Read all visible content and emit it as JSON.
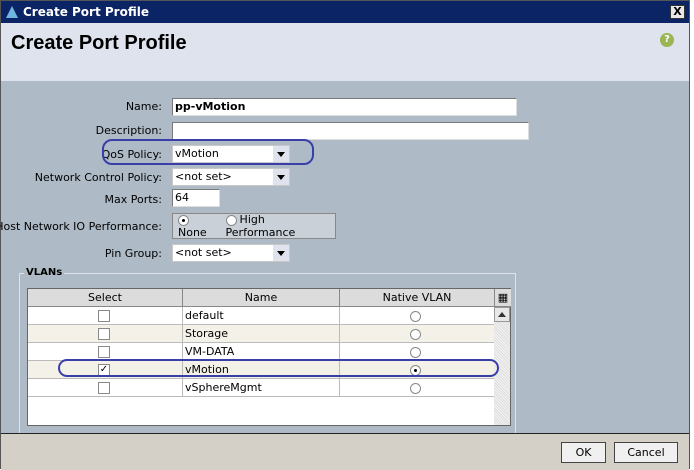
{
  "window": {
    "title": "Create Port Profile",
    "close": "X"
  },
  "header": {
    "title": "Create Port Profile",
    "help": "?"
  },
  "form": {
    "name_label": "Name:",
    "name_value": "pp-vMotion",
    "description_label": "Description:",
    "description_value": "",
    "qos_label": "QoS Policy:",
    "qos_value": "vMotion",
    "ncp_label": "Network Control Policy:",
    "ncp_value": "<not set>",
    "maxports_label": "Max Ports:",
    "maxports_value": "64",
    "hostio_label": "Host Network IO Performance:",
    "hostio_options": [
      "None",
      "High Performance"
    ],
    "hostio_selected": "None",
    "pingroup_label": "Pin Group:",
    "pingroup_value": "<not set>"
  },
  "vlans": {
    "legend": "VLANs",
    "columns": [
      "Select",
      "Name",
      "Native VLAN"
    ],
    "rows": [
      {
        "name": "default",
        "selected": false,
        "native": false
      },
      {
        "name": "Storage",
        "selected": false,
        "native": false
      },
      {
        "name": "VM-DATA",
        "selected": false,
        "native": false
      },
      {
        "name": "vMotion",
        "selected": true,
        "native": true
      },
      {
        "name": "vSphereMgmt",
        "selected": false,
        "native": false
      }
    ]
  },
  "footer": {
    "ok": "OK",
    "cancel": "Cancel"
  },
  "colors": {
    "titlebar": "#0b2466",
    "annotation": "#3a3fa8"
  }
}
